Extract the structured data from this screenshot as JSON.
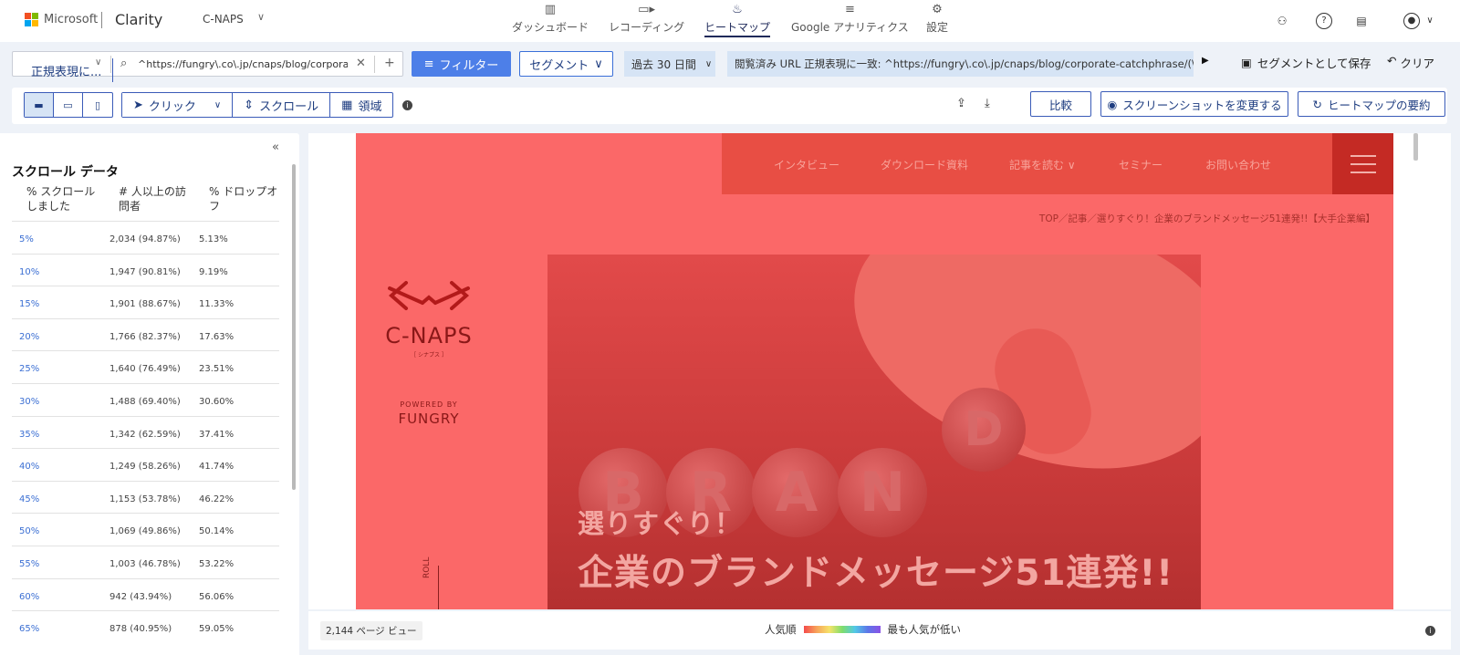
{
  "header": {
    "ms_brand": "Microsoft",
    "app": "Clarity",
    "project": "C-NAPS",
    "nav": [
      {
        "label": "ダッシュボード",
        "icon": "dashboard-icon"
      },
      {
        "label": "レコーディング",
        "icon": "video-icon"
      },
      {
        "label": "ヒートマップ",
        "icon": "flame-icon"
      },
      {
        "label": "Google アナリティクス",
        "icon": "analytics-icon"
      },
      {
        "label": "設定",
        "icon": "gear-icon"
      }
    ],
    "active_nav": "ヒートマップ"
  },
  "filters": {
    "match_mode": "正規表現に...",
    "url": "^https://fungry\\.co\\.jp/cnaps/blog/corporat...",
    "filter_label": "フィルター",
    "segment_label": "セグメント",
    "date_range": "過去 30 日間",
    "applied_filter": "閲覧済み URL 正規表現に一致: ^https://fungry\\.co\\.jp/cnaps/blog/corporate-catchphrase/(\\?.*)?$",
    "save_segment": "セグメントとして保存",
    "clear": "クリア"
  },
  "toolbar": {
    "devices": [
      "desktop",
      "tablet",
      "mobile"
    ],
    "modes": [
      {
        "label": "クリック",
        "icon": "cursor-icon"
      },
      {
        "label": "スクロール",
        "icon": "scroll-icon"
      },
      {
        "label": "領域",
        "icon": "area-icon"
      }
    ],
    "compare": "比較",
    "change_screenshot": "スクリーンショットを変更する",
    "summary": "ヒートマップの要約"
  },
  "scroll_panel": {
    "title": "スクロール データ",
    "col1": "% スクロールしました",
    "col2": "# 人以上の訪問者",
    "col3": "% ドロップオフ",
    "rows": [
      {
        "pct": "5%",
        "visitors": "2,034 (94.87%)",
        "dropoff": "5.13%"
      },
      {
        "pct": "10%",
        "visitors": "1,947 (90.81%)",
        "dropoff": "9.19%"
      },
      {
        "pct": "15%",
        "visitors": "1,901 (88.67%)",
        "dropoff": "11.33%"
      },
      {
        "pct": "20%",
        "visitors": "1,766 (82.37%)",
        "dropoff": "17.63%"
      },
      {
        "pct": "25%",
        "visitors": "1,640 (76.49%)",
        "dropoff": "23.51%"
      },
      {
        "pct": "30%",
        "visitors": "1,488 (69.40%)",
        "dropoff": "30.60%"
      },
      {
        "pct": "35%",
        "visitors": "1,342 (62.59%)",
        "dropoff": "37.41%"
      },
      {
        "pct": "40%",
        "visitors": "1,249 (58.26%)",
        "dropoff": "41.74%"
      },
      {
        "pct": "45%",
        "visitors": "1,153 (53.78%)",
        "dropoff": "46.22%"
      },
      {
        "pct": "50%",
        "visitors": "1,069 (49.86%)",
        "dropoff": "50.14%"
      },
      {
        "pct": "55%",
        "visitors": "1,003 (46.78%)",
        "dropoff": "53.22%"
      },
      {
        "pct": "60%",
        "visitors": "942 (43.94%)",
        "dropoff": "56.06%"
      },
      {
        "pct": "65%",
        "visitors": "878 (40.95%)",
        "dropoff": "59.05%"
      }
    ]
  },
  "site": {
    "nav": [
      "インタビュー",
      "ダウンロード資料",
      "記事を読む ∨",
      "セミナー",
      "お問い合わせ"
    ],
    "breadcrumb": "TOP／記事／選りすぐり！企業のブランドメッセージ51連発!!【大手企業編】",
    "logo": "C-NAPS",
    "logo_sub": "［ シナプス ］",
    "powered": "POWERED BY",
    "fungry": "FUNGRY",
    "balls": [
      "B",
      "R",
      "A",
      "N",
      "D"
    ],
    "hero_sub": "選りすぐり！",
    "hero_main": "企業のブランドメッセージ51連発!!",
    "side_label": "ROLL"
  },
  "bottom": {
    "pageviews": "2,144 ページ ビュー",
    "popular": "人気順",
    "least": "最も人気が低い"
  },
  "colors": {
    "accent": "#4d7fe8",
    "heat": "#fb6868"
  }
}
